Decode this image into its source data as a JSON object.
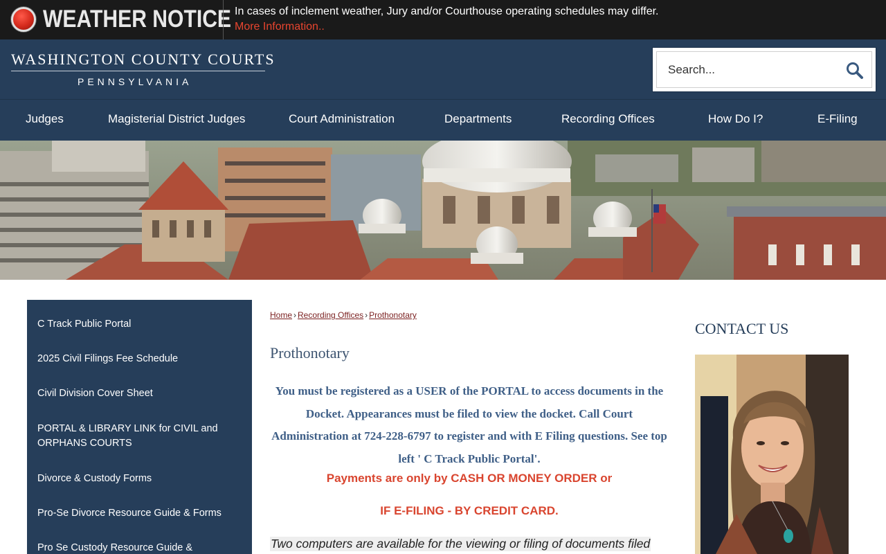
{
  "notice": {
    "title": "WEATHER NOTICE",
    "text": "In cases of inclement weather, Jury and/or Courthouse operating schedules may differ.",
    "link": "More Information.."
  },
  "header": {
    "logo_main": "WASHINGTON COUNTY COURTS",
    "logo_sub": "PENNSYLVANIA",
    "search_placeholder": "Search..."
  },
  "nav": [
    "Judges",
    "Magisterial District Judges",
    "Court Administration",
    "Departments",
    "Recording Offices",
    "How Do I?",
    "E-Filing"
  ],
  "sidebar": [
    "C Track Public Portal",
    "2025 Civil Filings Fee Schedule",
    "Civil Division Cover Sheet",
    "PORTAL & LIBRARY LINK for CIVIL and ORPHANS COURTS",
    "Divorce & Custody Forms",
    "Pro-Se Divorce Resource Guide & Forms",
    "Pro Se Custody Resource Guide &"
  ],
  "breadcrumb": {
    "home": "Home",
    "sep": "›",
    "section": "Recording Offices",
    "current": "Prothonotary"
  },
  "main": {
    "title": "Prothonotary",
    "registration_notice": "You must be registered as a USER of the PORTAL to access documents in the Docket. Appearances must be filed to view the docket. Call Court Administration at 724-228-6797 to register and with E Filing questions. See top left ' C Track Public Portal'.",
    "payment_line1": "Payments are only by CASH OR MONEY ORDER or",
    "payment_line2": "IF E-FILING - BY CREDIT CARD.",
    "computers_text": "Two computers are available for the viewing or filing of documents filed"
  },
  "right": {
    "contact_title": "CONTACT US"
  },
  "colors": {
    "navy": "#263e5a",
    "notice_bg": "#1a1a1a",
    "alert_red": "#d9452f",
    "notice_blue": "#3f5f87"
  }
}
